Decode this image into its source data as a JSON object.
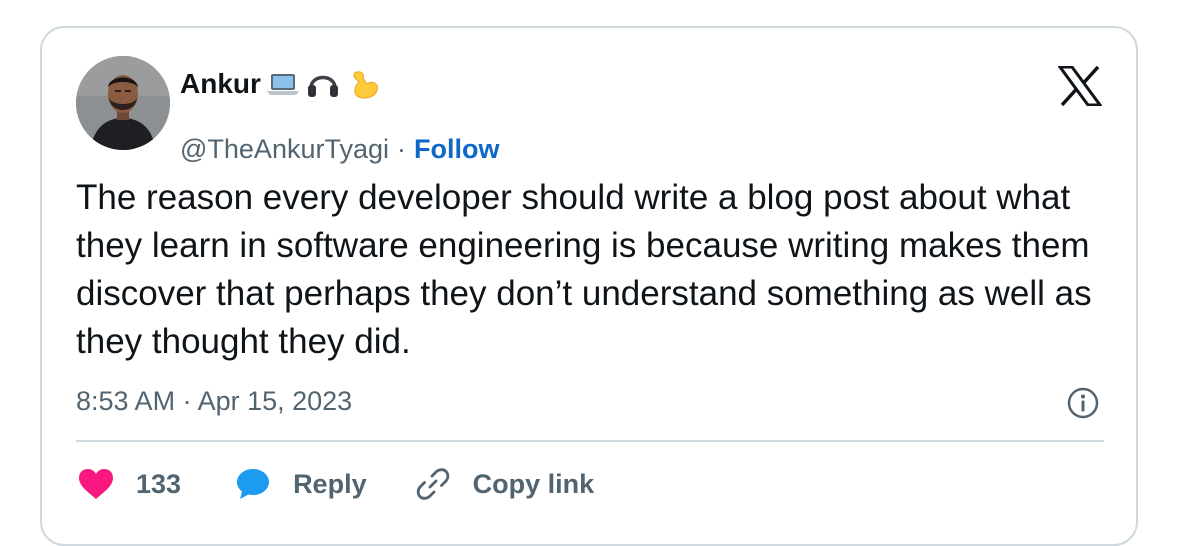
{
  "author": {
    "display_name": "Ankur",
    "emojis": [
      "laptop-emoji",
      "headphone-emoji",
      "flexed-biceps-emoji"
    ],
    "handle": "@TheAnkurTyagi",
    "separator": "·",
    "follow_label": "Follow"
  },
  "tweet": {
    "text": "The reason every developer should write a blog post about what they learn in software engineering is because writing makes them discover that perhaps they don’t understand something as well as they thought they did.",
    "timestamp": "8:53 AM · Apr 15, 2023"
  },
  "actions": {
    "like_count": "133",
    "reply_label": "Reply",
    "copy_link_label": "Copy link"
  },
  "icons": {
    "brand": "x-logo-icon",
    "info": "info-icon",
    "like": "heart-icon",
    "reply": "reply-bubble-icon",
    "copy_link": "link-icon"
  },
  "colors": {
    "text_primary": "#0f1419",
    "text_secondary": "#536471",
    "link_blue": "#0f68c7",
    "heart_pink": "#f91880",
    "reply_blue": "#1d9bf0",
    "border": "#cfd9de"
  }
}
